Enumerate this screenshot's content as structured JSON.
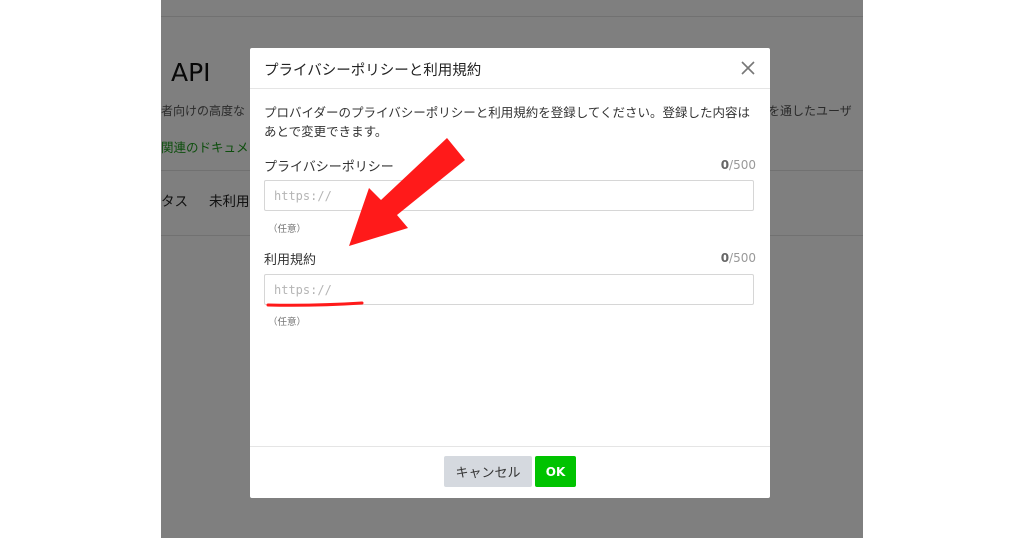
{
  "background_page": {
    "title": "API",
    "description_left": "者向けの高度な",
    "description_right": "を通したユーザ",
    "doc_link": "関連のドキュメ",
    "tabs": [
      "タス",
      "未利用"
    ]
  },
  "dialog": {
    "title": "プライバシーポリシーと利用規約",
    "description": "プロバイダーのプライバシーポリシーと利用規約を登録してください。登録した内容はあとで変更できます。",
    "privacy_policy": {
      "label": "プライバシーポリシー",
      "count": "0",
      "max": "/500",
      "placeholder": "https://",
      "value": "",
      "hint": "（任意）"
    },
    "terms": {
      "label": "利用規約",
      "count": "0",
      "max": "/500",
      "placeholder": "https://",
      "value": "",
      "hint": "（任意）"
    },
    "cancel_label": "キャンセル",
    "ok_label": "OK"
  },
  "colors": {
    "ok_button": "#00c300",
    "cancel_button": "#d5d9df",
    "annotation": "#ff1a1a",
    "link": "#1a9d1a"
  },
  "icons": {
    "close": "close-icon",
    "annotation_arrow": "red-arrow-icon"
  }
}
